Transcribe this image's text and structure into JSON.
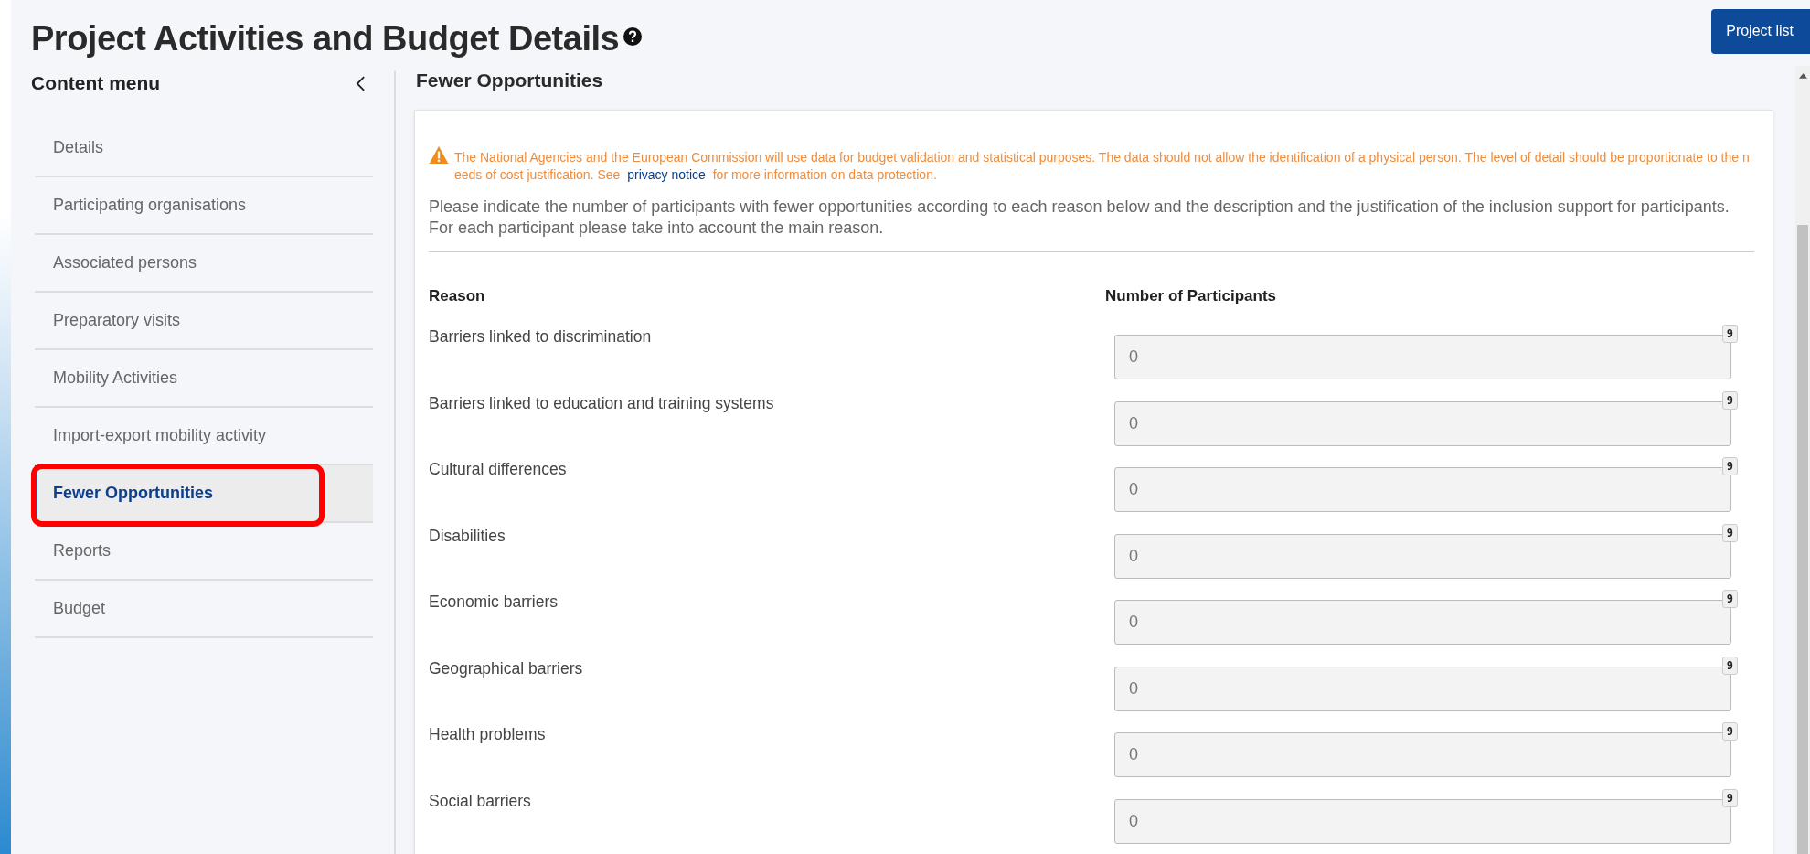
{
  "page": {
    "title": "Project Activities and Budget Details",
    "button": "Project list"
  },
  "sidebar": {
    "title": "Content menu",
    "items": [
      {
        "label": "Details",
        "selected": false
      },
      {
        "label": "Participating organisations",
        "selected": false
      },
      {
        "label": "Associated persons",
        "selected": false
      },
      {
        "label": "Preparatory visits",
        "selected": false
      },
      {
        "label": "Mobility Activities",
        "selected": false
      },
      {
        "label": "Import-export mobility activity",
        "selected": false
      },
      {
        "label": "Fewer Opportunities",
        "selected": true
      },
      {
        "label": "Reports",
        "selected": false
      },
      {
        "label": "Budget",
        "selected": false
      }
    ]
  },
  "section": {
    "title": "Fewer Opportunities",
    "warning": {
      "before": "The National Agencies and the European Commission will use data for budget validation and statistical purposes. The data should not allow the identification of a physical person. The level of detail should be proportionate to the needs of cost justification. See",
      "link": "privacy notice",
      "after": "for more information on data protection."
    },
    "intro": "Please indicate the number of participants with fewer opportunities according to each reason below and the description and the justification of the inclusion support for participants. For each participant please take into account the main reason.",
    "columns": [
      "Reason",
      "Number of Participants"
    ],
    "rows": [
      {
        "reason": "Barriers linked to discrimination",
        "value": "0",
        "badge": "9"
      },
      {
        "reason": "Barriers linked to education and training systems",
        "value": "0",
        "badge": "9"
      },
      {
        "reason": "Cultural differences",
        "value": "0",
        "badge": "9"
      },
      {
        "reason": "Disabilities",
        "value": "0",
        "badge": "9"
      },
      {
        "reason": "Economic barriers",
        "value": "0",
        "badge": "9"
      },
      {
        "reason": "Geographical barriers",
        "value": "0",
        "badge": "9"
      },
      {
        "reason": "Health problems",
        "value": "0",
        "badge": "9"
      },
      {
        "reason": "Social barriers",
        "value": "0",
        "badge": "9"
      }
    ]
  }
}
